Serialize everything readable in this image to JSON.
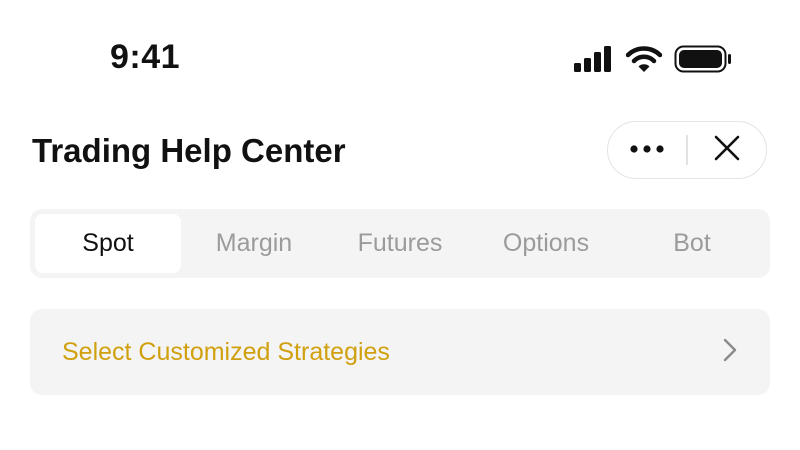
{
  "status_bar": {
    "time": "9:41",
    "icons": [
      "cellular-signal-icon",
      "wifi-icon",
      "battery-icon"
    ]
  },
  "header": {
    "title": "Trading Help Center",
    "buttons": [
      "more-icon",
      "close-icon"
    ]
  },
  "tabs": [
    {
      "label": "Spot",
      "active": true
    },
    {
      "label": "Margin",
      "active": false
    },
    {
      "label": "Futures",
      "active": false
    },
    {
      "label": "Options",
      "active": false
    },
    {
      "label": "Bot",
      "active": false
    }
  ],
  "strategy_row": {
    "label": "Select Customized Strategies",
    "icon": "chevron-right-icon"
  },
  "colors": {
    "accent": "#d1a00e",
    "tab_background": "#f4f4f4",
    "inactive_tab_text": "#9b9b9b"
  }
}
